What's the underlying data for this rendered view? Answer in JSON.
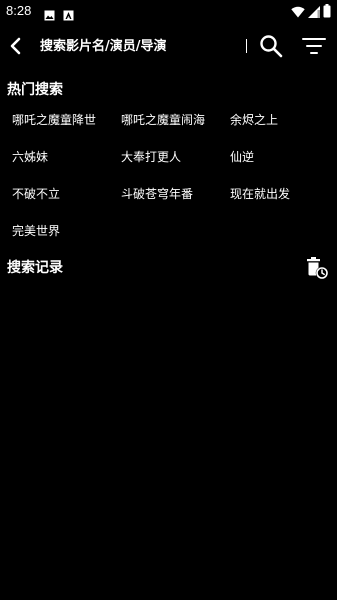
{
  "status_bar": {
    "time": "8:28",
    "icons": [
      "image-icon",
      "app-a-icon",
      "wifi-icon",
      "signal-icon",
      "battery-icon"
    ]
  },
  "toolbar": {
    "search_placeholder": "搜索影片名/演员/导演",
    "icons": [
      "back-arrow-icon",
      "search-icon",
      "filter-icon"
    ]
  },
  "hot_search": {
    "title": "热门搜索",
    "items": [
      "哪吒之魔童降世",
      "哪吒之魔童闹海",
      "余烬之上",
      "六姊妹",
      "大奉打更人",
      "仙逆",
      "不破不立",
      "斗破苍穹年番",
      "现在就出发",
      "完美世界"
    ]
  },
  "history": {
    "title": "搜索记录",
    "clear_icon": "delete-history-icon"
  },
  "colors": {
    "background": "#000000",
    "text": "#ffffff"
  }
}
